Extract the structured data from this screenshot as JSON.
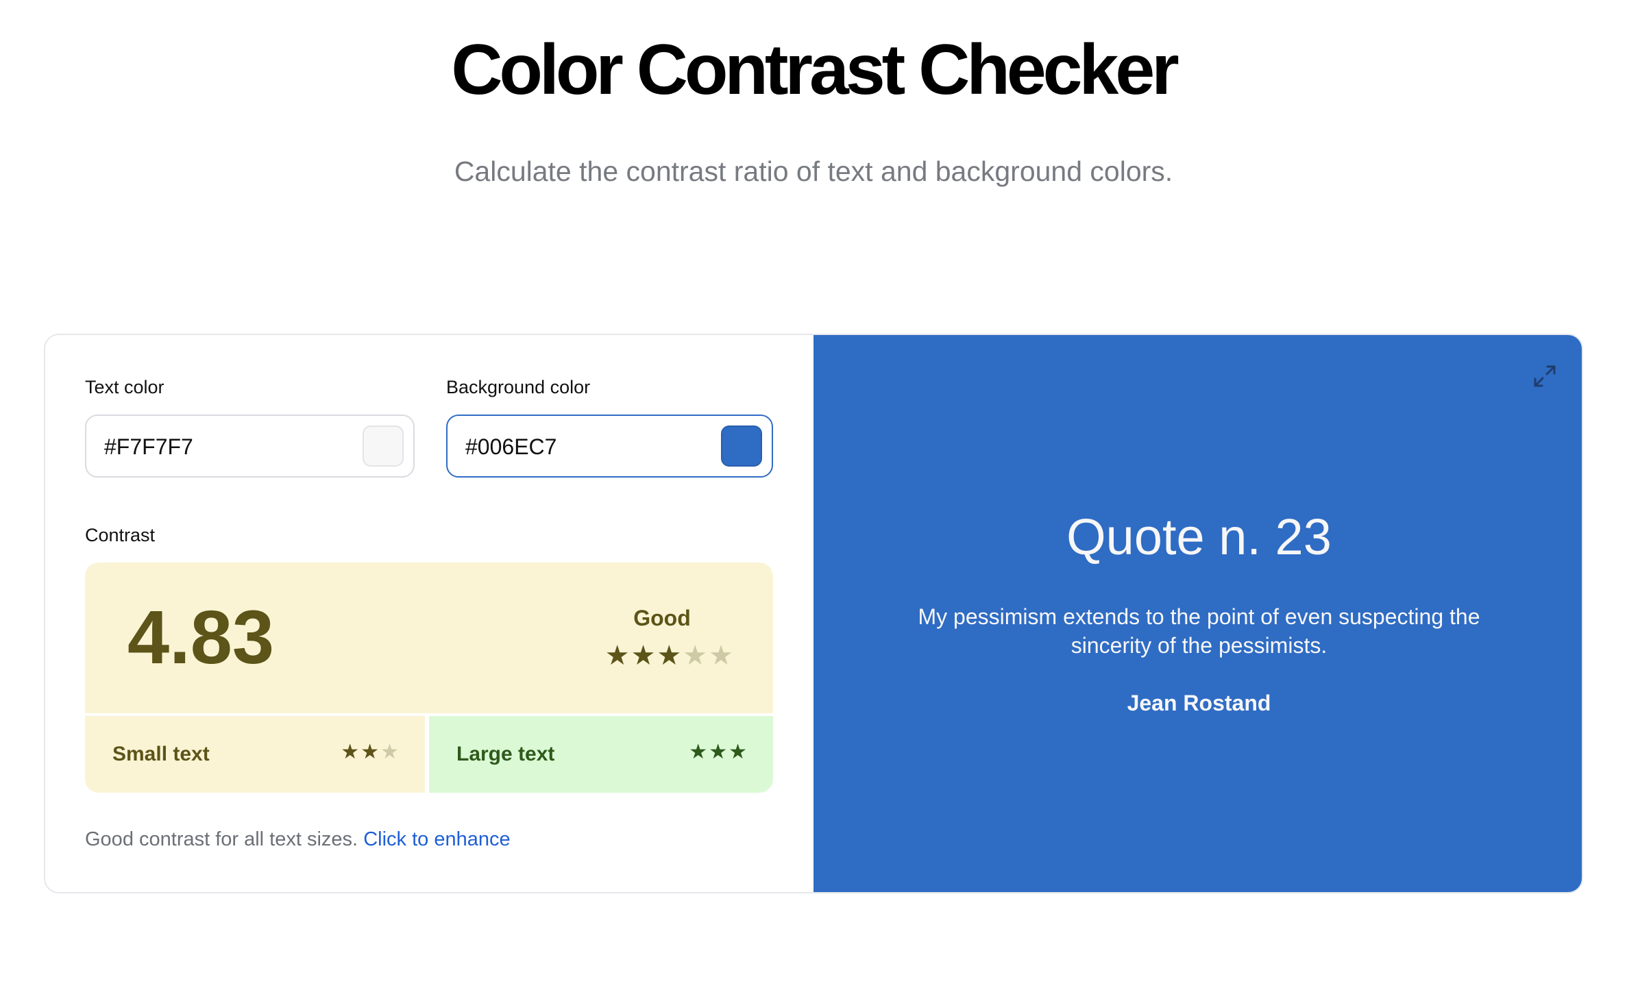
{
  "header": {
    "title": "Color Contrast Checker",
    "subtitle": "Calculate the contrast ratio of text and background colors."
  },
  "inputs": {
    "text_color": {
      "label": "Text color",
      "value": "#F7F7F7",
      "swatch": "#f7f7f7"
    },
    "background_color": {
      "label": "Background color",
      "value": "#006EC7",
      "swatch": "#2f6cc4"
    }
  },
  "contrast": {
    "label": "Contrast",
    "ratio": "4.83",
    "rating": "Good",
    "stars_filled": 3,
    "stars_total": 5,
    "small_text": {
      "label": "Small text",
      "stars_filled": 2,
      "stars_total": 3
    },
    "large_text": {
      "label": "Large text",
      "stars_filled": 3,
      "stars_total": 3
    }
  },
  "hint": {
    "text": "Good contrast for all text sizes.",
    "link": "Click to enhance"
  },
  "preview": {
    "title": "Quote n. 23",
    "quote": "My pessimism extends to the point of even suspecting the sincerity of the pessimists.",
    "author": "Jean Rostand",
    "expand_icon": "expand-icon"
  },
  "colors": {
    "accent": "#2f6dc4",
    "rating_bg": "#faf4d5",
    "rating_fg": "#5c5418",
    "large_bg": "#dcf9d5",
    "large_fg": "#2e5a1c",
    "link": "#1f5fd6"
  }
}
